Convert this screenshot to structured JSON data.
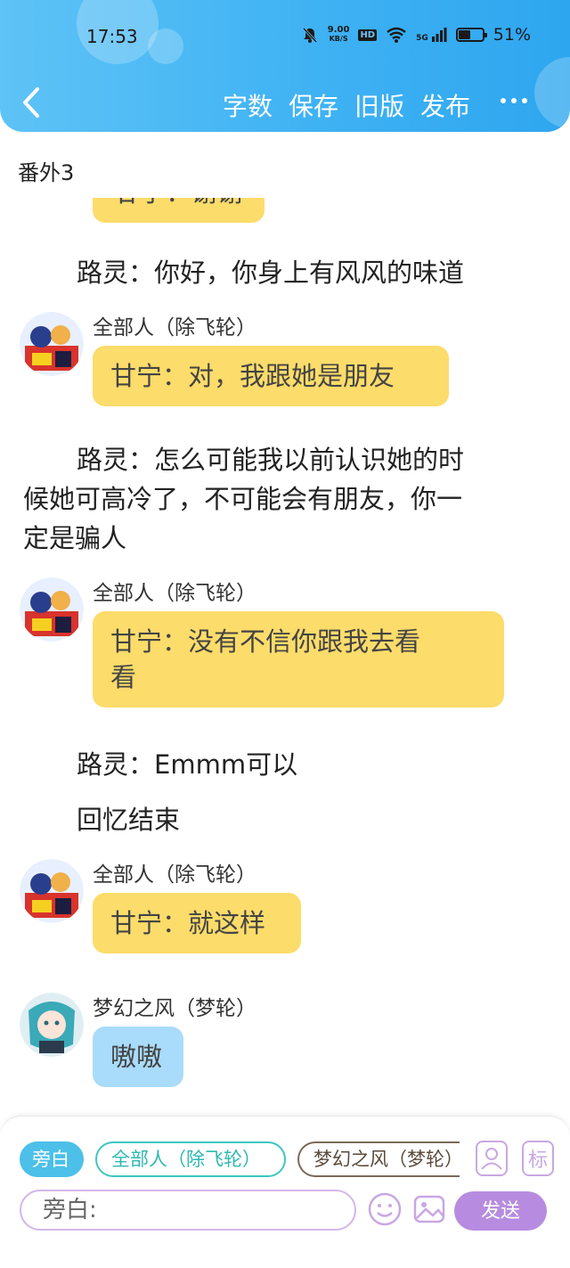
{
  "status_bar": {
    "time": "17:53",
    "net_speed_value": "9.00",
    "net_speed_unit": "KB/S",
    "hd_badge": "HD",
    "signal_label": "5G",
    "battery_percent": "51%",
    "battery_level": 0.51
  },
  "header": {
    "actions": [
      "字数",
      "保存",
      "旧版",
      "发布"
    ],
    "accent_color": "#3fb2f3"
  },
  "chapter_title": "番外3",
  "feed": {
    "partial_bubble_text": "甘宁：谢谢",
    "narration_1": "路灵：你好，你身上有风风的味道",
    "msg_1": {
      "name": "全部人（除飞轮）",
      "text": "甘宁：对，我跟她是朋友"
    },
    "narration_2_line1": "路灵：怎么可能我以前认识她的时",
    "narration_2_line2": "候她可高冷了，不可能会有朋友，你一",
    "narration_2_line3": "定是骗人",
    "msg_2": {
      "name": "全部人（除飞轮）",
      "text_line1": "甘宁：没有不信你跟我去看",
      "text_line2": "看"
    },
    "narration_3": "路灵：Emmm可以",
    "narration_4": "回忆结束",
    "msg_3": {
      "name": "全部人（除飞轮）",
      "text": "甘宁：就这样"
    },
    "msg_4": {
      "name": "梦幻之风（梦轮）",
      "text": "嗷嗷"
    }
  },
  "bottom_bar": {
    "chips": [
      "旁白",
      "全部人（除飞轮）",
      "梦幻之风（梦轮）"
    ],
    "mark_button": "标",
    "input_placeholder": "旁白:",
    "send_label": "发送"
  }
}
